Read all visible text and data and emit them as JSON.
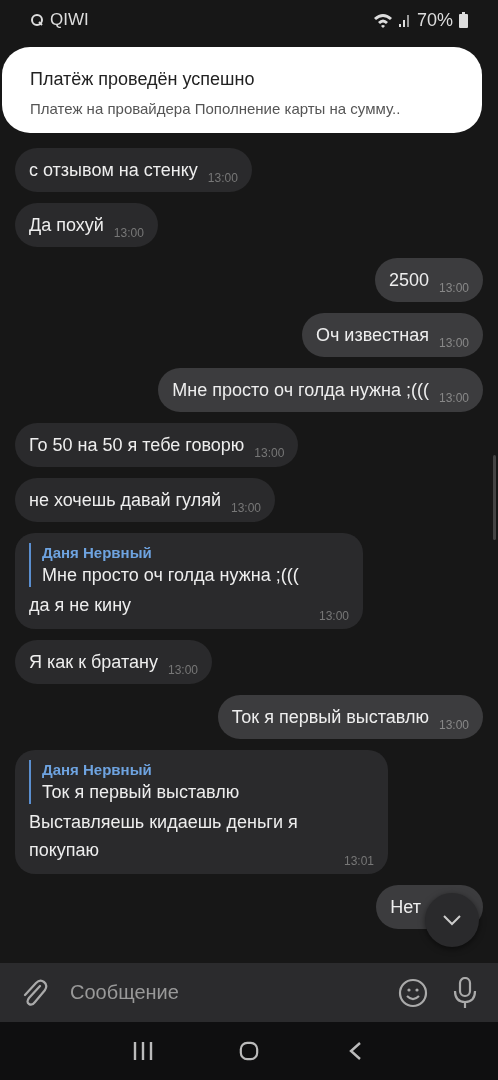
{
  "status_bar": {
    "app": "QIWI",
    "battery": "70%"
  },
  "notification": {
    "title": "Платёж проведён успешно",
    "body": "Платеж на провайдера Пополнение карты на сумму.."
  },
  "messages": [
    {
      "outgoing": false,
      "text": "с отзывом на стенку",
      "time": "13:00"
    },
    {
      "outgoing": false,
      "text": "Да похуй",
      "time": "13:00"
    },
    {
      "outgoing": true,
      "text": "2500",
      "time": "13:00"
    },
    {
      "outgoing": true,
      "text": "Оч известная",
      "time": "13:00"
    },
    {
      "outgoing": true,
      "text": "Мне просто оч голда нужна ;(((",
      "time": "13:00"
    },
    {
      "outgoing": false,
      "text": "Го 50 на 50 я тебе говорю",
      "time": "13:00"
    },
    {
      "outgoing": false,
      "text": "не хочешь давай гуляй",
      "time": "13:00"
    },
    {
      "outgoing": false,
      "reply": {
        "author": "Даня Нервный",
        "text": "Мне просто оч голда нужна ;((("
      },
      "text": "да я не кину",
      "time": "13:00"
    },
    {
      "outgoing": false,
      "text": "Я как к братану",
      "time": "13:00"
    },
    {
      "outgoing": true,
      "text": "Ток я первый выставлю",
      "time": "13:00"
    },
    {
      "outgoing": false,
      "reply": {
        "author": "Даня Нервный",
        "text": "Ток я первый выставлю"
      },
      "text": "Выставляешь кидаешь деньги я покупаю",
      "time": "13:01"
    },
    {
      "outgoing": true,
      "text": "Нет"
    }
  ],
  "composer": {
    "placeholder": "Сообщение"
  }
}
